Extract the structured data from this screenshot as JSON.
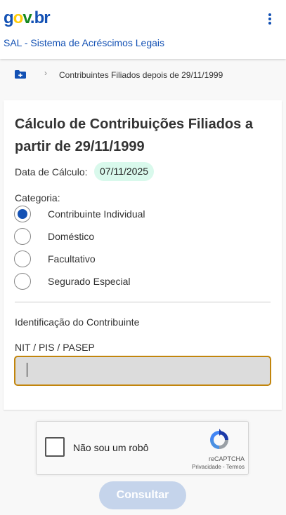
{
  "header": {
    "logo": {
      "g": "g",
      "o": "o",
      "v": "v",
      "dot": ".",
      "b": "br"
    },
    "system_title": "SAL - Sistema de Acréscimos Legais"
  },
  "breadcrumb": {
    "current": "Contribuintes Filiados depois de 29/11/1999"
  },
  "form": {
    "title": "Cálculo de Contribuições Filiados a partir de 29/11/1999",
    "date_label": "Data de Cálculo:",
    "date_value": "07/11/2025",
    "category_label": "Categoria:",
    "categories": [
      {
        "label": "Contribuinte Individual",
        "checked": true
      },
      {
        "label": "Doméstico",
        "checked": false
      },
      {
        "label": "Facultativo",
        "checked": false
      },
      {
        "label": "Segurado Especial",
        "checked": false
      }
    ],
    "section_title": "Identificação do Contribuinte",
    "nit_label": "NIT / PIS / PASEP",
    "nit_value": ""
  },
  "recaptcha": {
    "label": "Não sou um robô",
    "brand": "reCAPTCHA",
    "links": "Privacidade - Termos"
  },
  "submit_label": "Consultar",
  "colors": {
    "primary": "#1351b4",
    "focus_border": "#c2850c",
    "date_badge_bg": "#d9f9ec",
    "submit_disabled_bg": "#c5d4eb"
  }
}
